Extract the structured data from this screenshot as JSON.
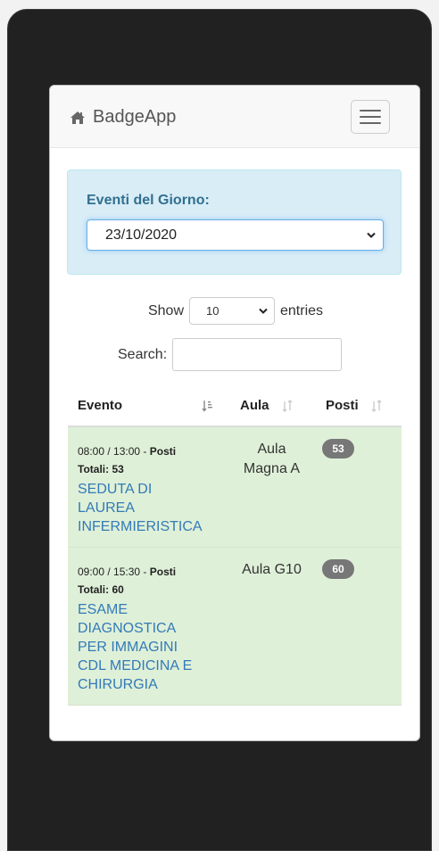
{
  "navbar": {
    "brand": "BadgeApp",
    "brand_icon": "home-icon",
    "toggle_icon": "hamburger-icon"
  },
  "events_filter": {
    "label": "Eventi del Giorno:",
    "selected_date": "23/10/2020"
  },
  "table_controls": {
    "show_label": "Show",
    "entries_value": "10",
    "entries_label": "entries",
    "search_label": "Search:",
    "search_value": ""
  },
  "table": {
    "headers": {
      "evento": "Evento",
      "aula": "Aula",
      "posti": "Posti"
    },
    "rows": [
      {
        "time": "08:00 / 13:00 - ",
        "posti_label": "Posti",
        "totali": "Totali: 53",
        "title_lines": [
          "SEDUTA DI",
          "LAUREA",
          "INFERMIERISTICA"
        ],
        "aula_lines": [
          "Aula",
          "Magna A"
        ],
        "posti": "53"
      },
      {
        "time": "09:00 / 15:30 - ",
        "posti_label": "Posti",
        "totali": "Totali: 60",
        "title_lines": [
          "ESAME",
          "DIAGNOSTICA",
          "PER IMMAGINI",
          "CDL MEDICINA E",
          "CHIRURGIA"
        ],
        "aula_lines": [
          "Aula G10"
        ],
        "posti": "60"
      }
    ]
  },
  "colors": {
    "row_bg": "#dff0d8",
    "link": "#337ab7",
    "alert_bg": "#d9edf7",
    "alert_text": "#31708f",
    "badge_bg": "#777777"
  }
}
